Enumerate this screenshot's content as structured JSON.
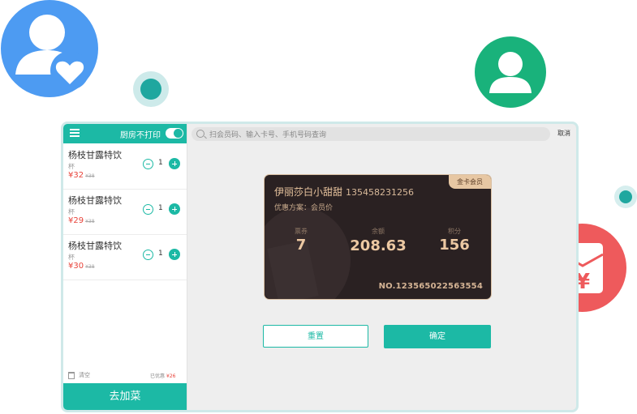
{
  "colors": {
    "accent": "#1cb9a5",
    "price_red": "#e8433a",
    "card_bg": "#2a2122",
    "card_gold": "#e8c49e"
  },
  "decor": {
    "icons": [
      "user-heart-icon",
      "user-icon",
      "red-packet-yen-icon"
    ],
    "yen_glyph": "¥"
  },
  "sidebar": {
    "menu_icon": "menu-icon",
    "kitchen_toggle_label": "厨房不打印",
    "kitchen_toggle_on": true,
    "items": [
      {
        "name": "杨枝甘露特饮",
        "unit": "杯",
        "price": "¥32",
        "orig_price": "¥38",
        "qty": "1"
      },
      {
        "name": "杨枝甘露特饮",
        "unit": "杯",
        "price": "¥29",
        "orig_price": "¥38",
        "qty": "1"
      },
      {
        "name": "杨枝甘露特饮",
        "unit": "杯",
        "price": "¥30",
        "orig_price": "¥38",
        "qty": "1"
      }
    ],
    "clear_label": "清空",
    "discount_label": "已优惠",
    "discount_amount": "¥26",
    "add_dish_label": "去加菜"
  },
  "search": {
    "placeholder": "扫会员码、输入卡号、手机号码查询",
    "cancel_label": "取消"
  },
  "card": {
    "badge": "金卡会员",
    "member_name": "伊丽莎白小甜甜",
    "phone": "135458231256",
    "scheme": "优惠方案：会员价",
    "stats": [
      {
        "label": "票券",
        "value": "7"
      },
      {
        "label": "余额",
        "value": "208.63"
      },
      {
        "label": "积分",
        "value": "156"
      }
    ],
    "card_no": "NO.123565022563554"
  },
  "actions": {
    "reset_label": "重置",
    "confirm_label": "确定"
  }
}
